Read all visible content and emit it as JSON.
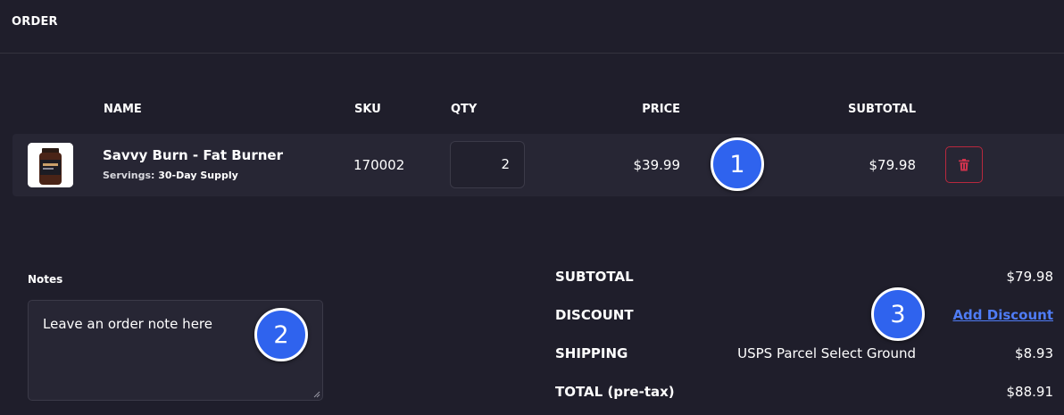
{
  "header": {
    "title": "ORDER"
  },
  "table": {
    "columns": {
      "name": "NAME",
      "sku": "SKU",
      "qty": "QTY",
      "price": "PRICE",
      "subtotal": "SUBTOTAL"
    },
    "items": [
      {
        "name": "Savvy Burn - Fat Burner",
        "option_label": "Servings:",
        "option_value": "30-Day Supply",
        "sku": "170002",
        "qty": "2",
        "price": "$39.99",
        "subtotal": "$79.98",
        "delete_icon": "trash-icon"
      }
    ]
  },
  "notes": {
    "label": "Notes",
    "value": "Leave an order note here"
  },
  "summary": {
    "subtotal_label": "SUBTOTAL",
    "subtotal_value": "$79.98",
    "discount_label": "DISCOUNT",
    "add_discount_link": "Add Discount",
    "shipping_label": "SHIPPING",
    "shipping_method": "USPS Parcel Select Ground",
    "shipping_value": "$8.93",
    "total_label": "TOTAL (pre-tax)",
    "total_value": "$88.91"
  },
  "annotations": [
    "1",
    "2",
    "3"
  ],
  "colors": {
    "background": "#1f1e2b",
    "row_background": "#272634",
    "delete_border": "#b8283e",
    "link": "#4f7cf5",
    "badge": "#2f63ee"
  }
}
